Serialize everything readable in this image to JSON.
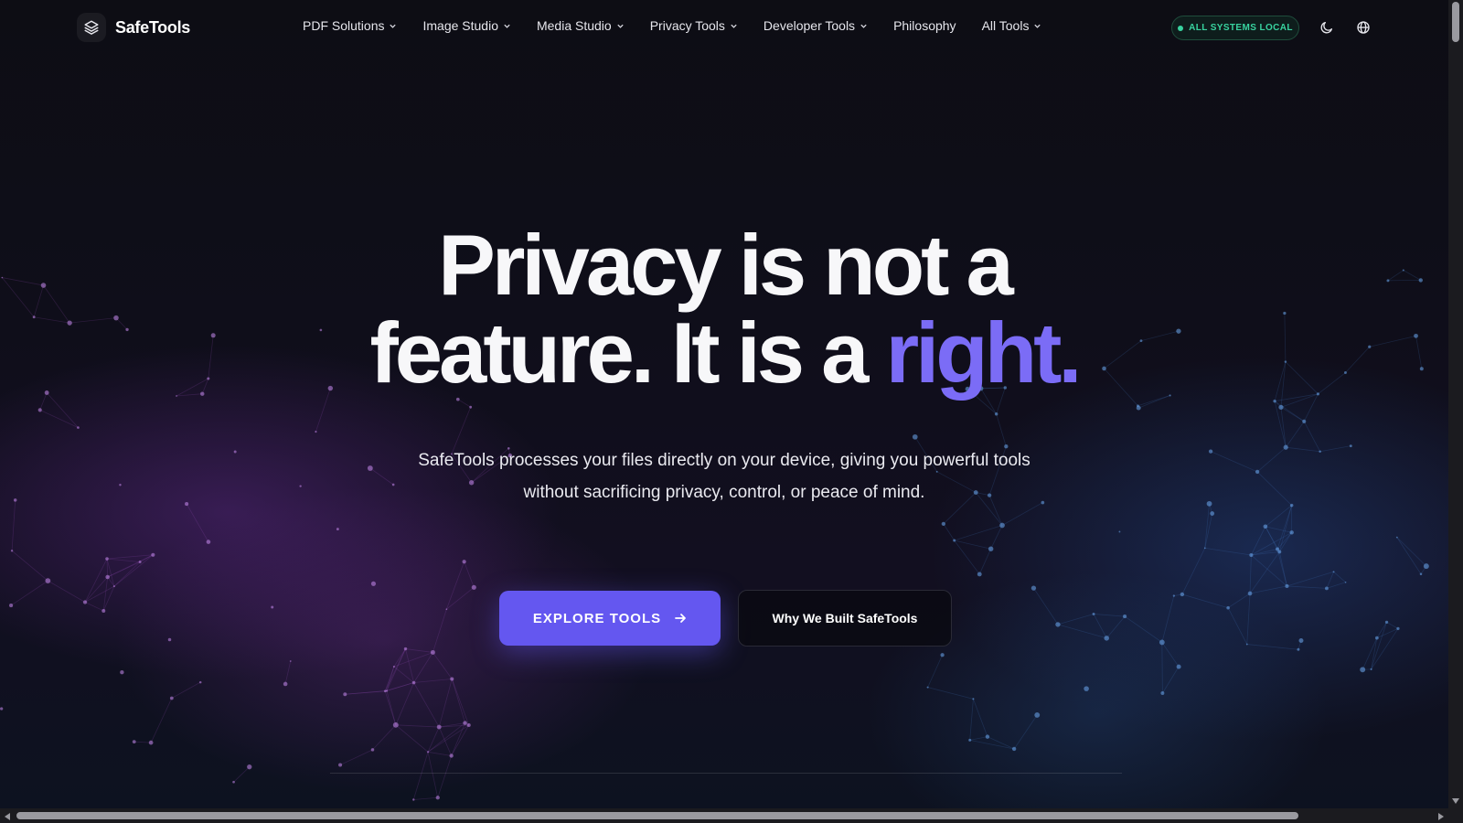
{
  "brand": {
    "name": "SafeTools",
    "icon": "layers-icon"
  },
  "nav": {
    "items": [
      {
        "label": "PDF Solutions",
        "has_dropdown": true
      },
      {
        "label": "Image Studio",
        "has_dropdown": true
      },
      {
        "label": "Media Studio",
        "has_dropdown": true
      },
      {
        "label": "Privacy Tools",
        "has_dropdown": true
      },
      {
        "label": "Developer Tools",
        "has_dropdown": true
      },
      {
        "label": "Philosophy",
        "has_dropdown": false
      },
      {
        "label": "All Tools",
        "has_dropdown": true
      }
    ],
    "status_label": "ALL SYSTEMS LOCAL",
    "theme_icon": "moon-icon",
    "language_icon": "globe-icon"
  },
  "hero": {
    "title_line1": "Privacy is not a",
    "title_line2_prefix": "feature. It is a ",
    "title_accent": "right.",
    "subtitle": "SafeTools processes your files directly on your device, giving you powerful tools without sacrificing privacy, control, or peace of mind.",
    "primary_cta": "EXPLORE TOOLS",
    "secondary_cta": "Why We Built SafeTools"
  },
  "colors": {
    "accent": "#7b6cf6",
    "primary_button": "#6457f0",
    "status_green": "#38d39f",
    "background": "#0b0b12"
  }
}
